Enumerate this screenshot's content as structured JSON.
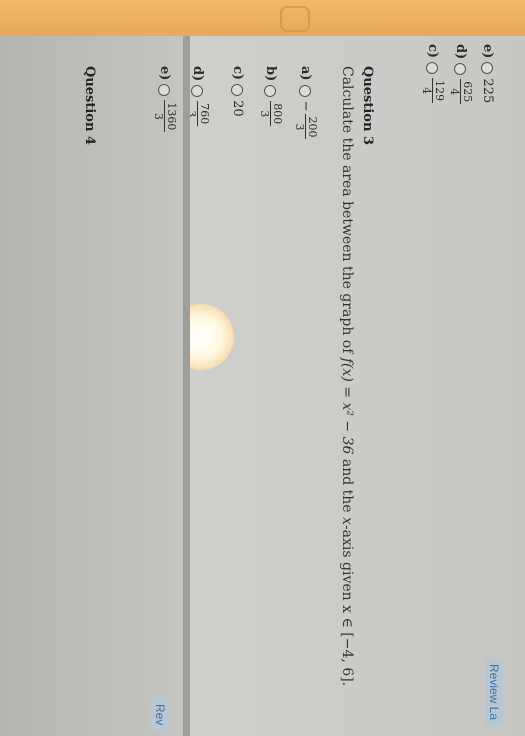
{
  "prev_question": {
    "options": [
      {
        "letter": "c)",
        "numerator": "129",
        "denominator": "4",
        "negative": false
      },
      {
        "letter": "d)",
        "numerator": "625",
        "denominator": "4",
        "negative": false
      },
      {
        "letter": "e)",
        "value": "225"
      }
    ]
  },
  "question3": {
    "heading": "Question 3",
    "text_prefix": "Calculate the area between the graph of ",
    "function_text": "f(x) = x² − 36",
    "text_middle": " and the ",
    "axis_text": "x",
    "text_suffix": "-axis given ",
    "interval_text": "x ∈ [−4, 6].",
    "options": [
      {
        "letter": "a)",
        "numerator": "200",
        "denominator": "3",
        "negative": true
      },
      {
        "letter": "b)",
        "numerator": "800",
        "denominator": "3",
        "negative": false
      },
      {
        "letter": "c)",
        "value": "20"
      },
      {
        "letter": "d)",
        "numerator": "760",
        "denominator": "3",
        "negative": false
      },
      {
        "letter": "e)",
        "numerator": "1360",
        "denominator": "3",
        "negative": false
      }
    ],
    "review_label": "Review La"
  },
  "question4": {
    "heading": "Question 4",
    "review_label": "Rev"
  }
}
